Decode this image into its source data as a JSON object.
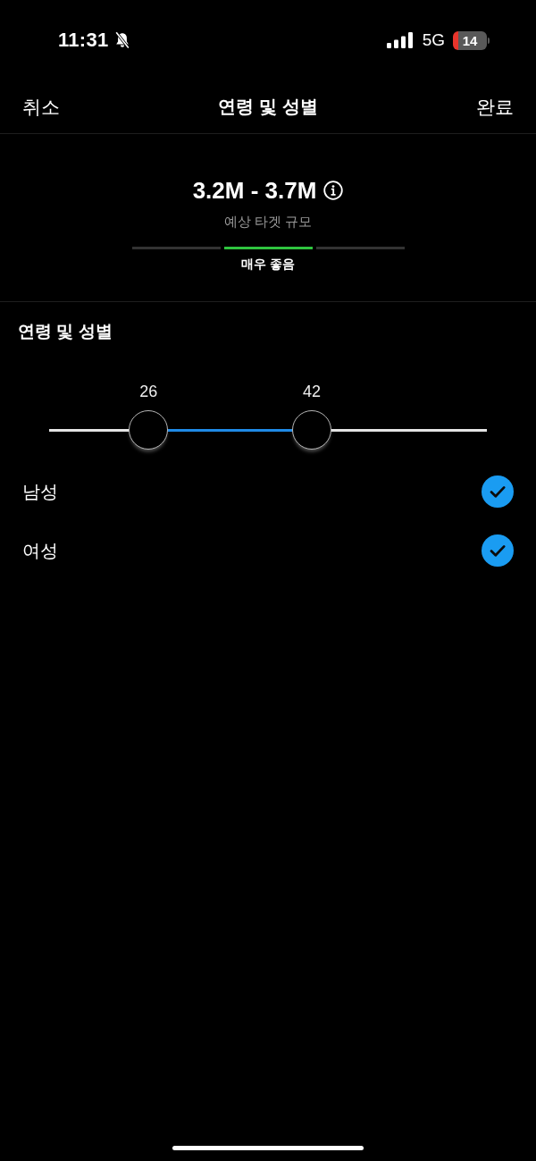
{
  "status_bar": {
    "time": "11:31",
    "network": "5G",
    "battery": "14"
  },
  "nav": {
    "cancel": "취소",
    "title": "연령 및 성별",
    "done": "완료"
  },
  "audience_estimate": {
    "range": "3.2M - 3.7M",
    "caption": "예상 타겟 규모",
    "segments": [
      {
        "selected": false
      },
      {
        "selected": true
      },
      {
        "selected": false
      }
    ],
    "rating": "매우 좋음"
  },
  "age_gender": {
    "title": "연령 및 성별",
    "age_slider": {
      "thumbs": [
        {
          "label": "26",
          "level": 0.227
        },
        {
          "label": "42",
          "level": 0.6
        }
      ]
    },
    "options": [
      {
        "label": "남성",
        "checked": true
      },
      {
        "label": "여성",
        "checked": true
      }
    ]
  }
}
